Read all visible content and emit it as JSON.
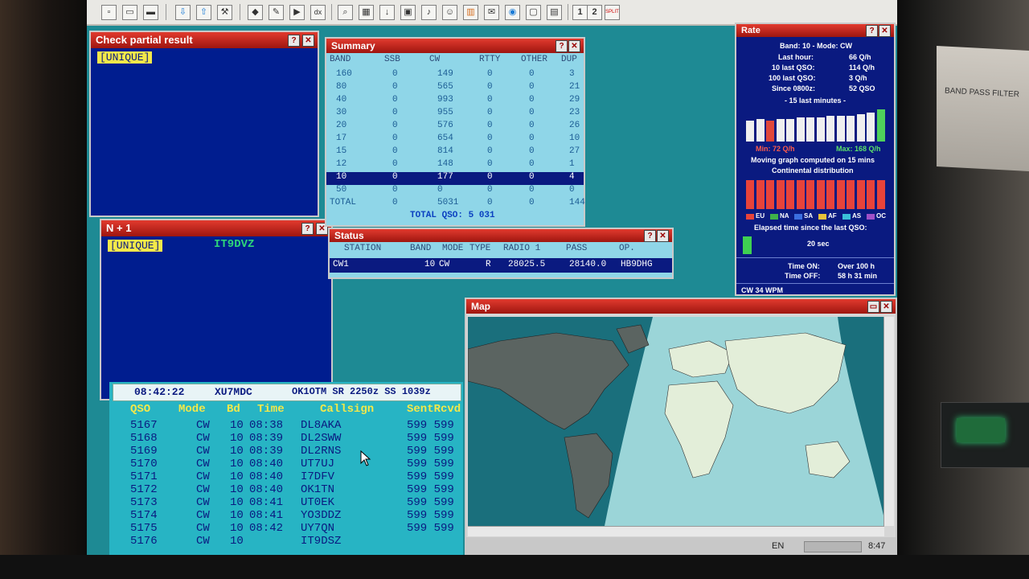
{
  "colors": {
    "title_bar": "#c4221a",
    "window_bg": "#001d8f",
    "summary_bg": "#8fd6e8",
    "highlight": "#f3e84a",
    "log_bg": "#27b4c4"
  },
  "toolbar": {
    "icons": [
      "new-icon",
      "open-icon",
      "folder-icon",
      "arrow-down-icon",
      "arrow-up-icon",
      "tools-icon",
      "tag-icon",
      "note-icon",
      "play-icon",
      "dx-icon",
      "zoom-icon",
      "grid-icon",
      "download-icon",
      "chat-icon",
      "bell-icon",
      "person-icon",
      "chart-icon",
      "envelope-icon",
      "globe-icon",
      "monitor-icon",
      "clipboard-icon",
      "one-icon",
      "two-icon",
      "split-icon"
    ],
    "dx_label": "dx",
    "split_label": "SPLIT",
    "one_label": "1",
    "two_label": "2"
  },
  "check_partial": {
    "title": "Check partial result",
    "tag": "[UNIQUE]"
  },
  "n1": {
    "title": "N + 1",
    "tag": "[UNIQUE]",
    "call": "IT9DVZ"
  },
  "summary": {
    "title": "Summary",
    "headers": [
      "BAND",
      "SSB",
      "CW",
      "RTTY",
      "OTHER",
      "DUP"
    ],
    "rows": [
      [
        "160",
        "0",
        "149",
        "0",
        "0",
        "3"
      ],
      [
        "80",
        "0",
        "565",
        "0",
        "0",
        "21"
      ],
      [
        "40",
        "0",
        "993",
        "0",
        "0",
        "29"
      ],
      [
        "30",
        "0",
        "955",
        "0",
        "0",
        "23"
      ],
      [
        "20",
        "0",
        "576",
        "0",
        "0",
        "26"
      ],
      [
        "17",
        "0",
        "654",
        "0",
        "0",
        "10"
      ],
      [
        "15",
        "0",
        "814",
        "0",
        "0",
        "27"
      ],
      [
        "12",
        "0",
        "148",
        "0",
        "0",
        "1"
      ],
      [
        "10",
        "0",
        "177",
        "0",
        "0",
        "4"
      ],
      [
        "50",
        "0",
        "0",
        "0",
        "0",
        "0"
      ]
    ],
    "total_row": [
      "TOTAL",
      "0",
      "5031",
      "0",
      "0",
      "144"
    ],
    "total_qso": "TOTAL QSO: 5 031"
  },
  "status": {
    "title": "Status",
    "headers": [
      "STATION",
      "BAND",
      "MODE",
      "TYPE",
      "RADIO 1",
      "PASS",
      "OP."
    ],
    "row": [
      "CW1",
      "10",
      "CW",
      "R",
      "28025.5",
      "28140.0",
      "HB9DHG"
    ]
  },
  "rate": {
    "title": "Rate",
    "band_mode": "Band: 10 - Mode: CW",
    "lines": [
      {
        "label": "Last hour:",
        "value": "66 Q/h"
      },
      {
        "label": "10 last QSO:",
        "value": "114 Q/h"
      },
      {
        "label": "100 last QSO:",
        "value": "3 Q/h"
      },
      {
        "label": "Since 0800z:",
        "value": "52 QSO"
      }
    ],
    "last15": "- 15 last minutes -",
    "min_label": "Min: 72 Q/h",
    "max_label": "Max: 168 Q/h",
    "moving": "Moving graph computed on 15 mins",
    "continental": "Continental distribution",
    "continents": [
      "EU",
      "NA",
      "SA",
      "AF",
      "AS",
      "OC"
    ],
    "elapsed_label": "Elapsed time since the last QSO:",
    "elapsed_value": "20 sec",
    "time_on_label": "Time ON:",
    "time_on_value": "Over 100 h",
    "time_off_label": "Time OFF:",
    "time_off_value": "58 h 31 min",
    "cw_speed": "CW 34 WPM"
  },
  "map": {
    "title": "Map"
  },
  "log": {
    "time": "08:42:22",
    "call": "XU7MDC",
    "info": "OK1OTM SR 2250z SS 1039z",
    "headers": {
      "qso": "QSO",
      "mode": "Mode",
      "band": "Bd",
      "time": "Time",
      "callsign": "Callsign",
      "sentrcvd": "SentRcvd"
    },
    "rows": [
      {
        "qso": "5167",
        "mode": "CW",
        "band": "10",
        "time": "08:38",
        "call": "DL8AKA",
        "rst": "599 599"
      },
      {
        "qso": "5168",
        "mode": "CW",
        "band": "10",
        "time": "08:39",
        "call": "DL2SWW",
        "rst": "599 599"
      },
      {
        "qso": "5169",
        "mode": "CW",
        "band": "10",
        "time": "08:39",
        "call": "DL2RNS",
        "rst": "599 599"
      },
      {
        "qso": "5170",
        "mode": "CW",
        "band": "10",
        "time": "08:40",
        "call": "UT7UJ",
        "rst": "599 599"
      },
      {
        "qso": "5171",
        "mode": "CW",
        "band": "10",
        "time": "08:40",
        "call": "I7DFV",
        "rst": "599 599"
      },
      {
        "qso": "5172",
        "mode": "CW",
        "band": "10",
        "time": "08:40",
        "call": "OK1TN",
        "rst": "599 599"
      },
      {
        "qso": "5173",
        "mode": "CW",
        "band": "10",
        "time": "08:41",
        "call": "UT0EK",
        "rst": "599 599"
      },
      {
        "qso": "5174",
        "mode": "CW",
        "band": "10",
        "time": "08:41",
        "call": "YO3DDZ",
        "rst": "599 599"
      },
      {
        "qso": "5175",
        "mode": "CW",
        "band": "10",
        "time": "08:42",
        "call": "UY7QN",
        "rst": "599 599"
      },
      {
        "qso": "5176",
        "mode": "CW",
        "band": "10",
        "time": "",
        "call": "IT9DSZ",
        "rst": ""
      }
    ]
  },
  "taskbar": {
    "lang": "EN",
    "clock": "8:47"
  },
  "device_label": "BAND PASS FILTER"
}
